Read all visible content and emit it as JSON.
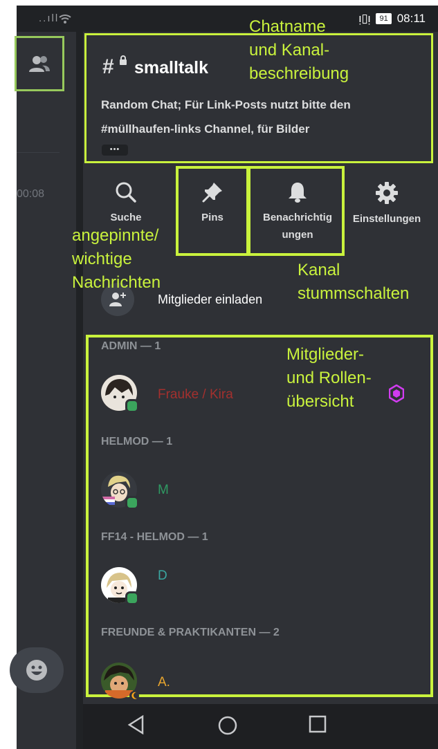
{
  "status": {
    "signal": "..ıll",
    "time": "08:11",
    "battery": "91"
  },
  "ghost": {
    "time": "00:08"
  },
  "channel": {
    "name": "smalltalk",
    "topic_line1": "Random Chat; Für Link-Posts nutzt bitte den",
    "topic_line2": "#müllhaufen-links Channel, für Bilder",
    "more": "•••"
  },
  "actions": {
    "search": "Suche",
    "pins": "Pins",
    "notifications_line1": "Benachrichtig",
    "notifications_line2": "ungen",
    "settings": "Einstellungen"
  },
  "invite": {
    "label": "Mitglieder einladen"
  },
  "roles": [
    {
      "header": "ADMIN — 1",
      "member": "Frauke / Kira",
      "color": "#a3302e"
    },
    {
      "header": "HELMOD — 1",
      "member": "M",
      "color": "#2f9a63"
    },
    {
      "header": "FF14 - HELMOD — 1",
      "member": "D",
      "color": "#3aa6a0"
    },
    {
      "header": "FREUNDE & PRAKTIKANTEN — 2",
      "member": "A.",
      "color": "#e8a52e"
    }
  ],
  "annotations": {
    "chatname_l1": "Chatname",
    "chatname_l2": "und Kanal-",
    "chatname_l3": "beschreibung",
    "pins_l1": "angepinnte/",
    "pins_l2": "wichtige",
    "pins_l3": "Nachrichten",
    "mute_l1": "Kanal",
    "mute_l2": "stummschalten",
    "members_l1": "Mitglieder-",
    "members_l2": "und Rollen-",
    "members_l3": "übersicht"
  },
  "colors": {
    "annotation": "#c9f23d",
    "members_button_highlight": "#97c95c",
    "background": "#2f3136",
    "online": "#3ba55d",
    "nitro": "#d13cf0"
  },
  "icons": {
    "members": "members-icon",
    "search": "search-icon",
    "pins": "pin-icon",
    "notifications": "bell-icon",
    "settings": "gear-icon",
    "invite": "add-user-icon",
    "emoji": "emoji-icon",
    "nav_back": "triangle-back-icon",
    "nav_home": "circle-home-icon",
    "nav_recent": "square-recent-icon"
  }
}
